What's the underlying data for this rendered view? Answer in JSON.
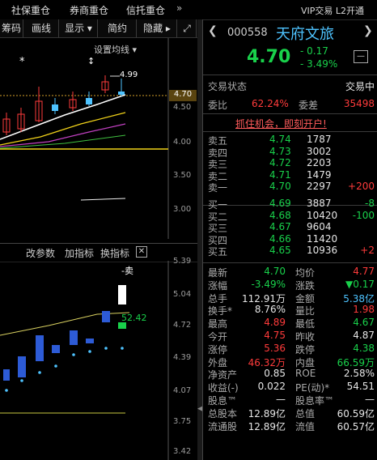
{
  "tabs": {
    "t1": "社保重仓",
    "t2": "券商重仓",
    "t3": "信托重仓",
    "more": "»",
    "vip": "VIP交易  L2开通"
  },
  "toolbar": {
    "b0": "筹码",
    "b1": "画线",
    "b2": "显示 ▾",
    "b3": "简约",
    "b4": "隐藏 ▸",
    "b5": "⤢"
  },
  "chart1": {
    "setting": "设置均线 ▾",
    "high_marker": "4.99",
    "star1": "*",
    "star2": "↕",
    "price_axis": [
      "4.70",
      "4.50",
      "4.00",
      "3.50",
      "3.00"
    ]
  },
  "chart2": {
    "menu": [
      "改参数",
      "加指标",
      "换指标"
    ],
    "close": "✕",
    "sell_tag": "-卖",
    "value_tag": "52.42",
    "axis": [
      "5.39",
      "5.04",
      "4.72",
      "4.39",
      "4.07",
      "3.75",
      "3.42"
    ]
  },
  "stock": {
    "code": "000558",
    "name": "天府文旅",
    "price": "4.70",
    "change": "- 0.17",
    "change_pct": "- 3.49%",
    "toggle": "—"
  },
  "status": {
    "label": "交易状态",
    "value": "交易中"
  },
  "ratio": {
    "l1": "委比",
    "v1": "62.24%",
    "l2": "委差",
    "v2": "35498"
  },
  "promo": "抓住机会，即刻开户!",
  "sells": [
    {
      "label": "卖五",
      "price": "4.74",
      "vol": "1787",
      "chg": ""
    },
    {
      "label": "卖四",
      "price": "4.73",
      "vol": "3002",
      "chg": ""
    },
    {
      "label": "卖三",
      "price": "4.72",
      "vol": "2203",
      "chg": ""
    },
    {
      "label": "卖二",
      "price": "4.71",
      "vol": "1479",
      "chg": ""
    },
    {
      "label": "卖一",
      "price": "4.70",
      "vol": "2297",
      "chg": "+200"
    }
  ],
  "buys": [
    {
      "label": "买一",
      "price": "4.69",
      "vol": "3887",
      "chg": "-8"
    },
    {
      "label": "买二",
      "price": "4.68",
      "vol": "10420",
      "chg": "-100"
    },
    {
      "label": "买三",
      "price": "4.67",
      "vol": "9604",
      "chg": ""
    },
    {
      "label": "买四",
      "price": "4.66",
      "vol": "11420",
      "chg": ""
    },
    {
      "label": "买五",
      "price": "4.65",
      "vol": "10936",
      "chg": "+2"
    }
  ],
  "stats": [
    {
      "l1": "最新",
      "v1": "4.70",
      "c1": "g",
      "l2": "均价",
      "v2": "4.77",
      "c2": "r"
    },
    {
      "l1": "涨幅",
      "v1": "-3.49%",
      "c1": "g",
      "l2": "涨跌",
      "v2": "▼0.17",
      "c2": "g"
    },
    {
      "l1": "总手",
      "v1": "112.91万",
      "c1": "w",
      "l2": "金额",
      "v2": "5.38亿",
      "c2": "c"
    },
    {
      "l1": "换手*",
      "v1": "8.76%",
      "c1": "w",
      "l2": "量比",
      "v2": "1.98",
      "c2": "r"
    },
    {
      "l1": "最高",
      "v1": "4.89",
      "c1": "r",
      "l2": "最低",
      "v2": "4.67",
      "c2": "g"
    },
    {
      "l1": "今开",
      "v1": "4.75",
      "c1": "r",
      "l2": "昨收",
      "v2": "4.87",
      "c2": "w"
    },
    {
      "l1": "涨停",
      "v1": "5.36",
      "c1": "r",
      "l2": "跌停",
      "v2": "4.38",
      "c2": "g"
    },
    {
      "l1": "外盘",
      "v1": "46.32万",
      "c1": "r",
      "l2": "内盘",
      "v2": "66.59万",
      "c2": "g"
    },
    {
      "l1": "净资产",
      "v1": "0.85",
      "c1": "w",
      "l2": "ROE",
      "v2": "2.58%",
      "c2": "w"
    },
    {
      "l1": "收益(-)",
      "v1": "0.022",
      "c1": "w",
      "l2": "PE(动)*",
      "v2": "54.51",
      "c2": "w"
    },
    {
      "l1": "股息™",
      "v1": "—",
      "c1": "w",
      "l2": "股息率™",
      "v2": "—",
      "c2": "w"
    },
    {
      "l1": "总股本",
      "v1": "12.89亿",
      "c1": "w",
      "l2": "总值",
      "v2": "60.59亿",
      "c2": "w"
    },
    {
      "l1": "流通股",
      "v1": "12.89亿",
      "c1": "w",
      "l2": "流值",
      "v2": "60.57亿",
      "c2": "w"
    }
  ],
  "colors": {
    "up": "#ff3b3b",
    "down": "#19d14b",
    "cyan": "#4ec3ff",
    "yellow": "#f1d219"
  }
}
